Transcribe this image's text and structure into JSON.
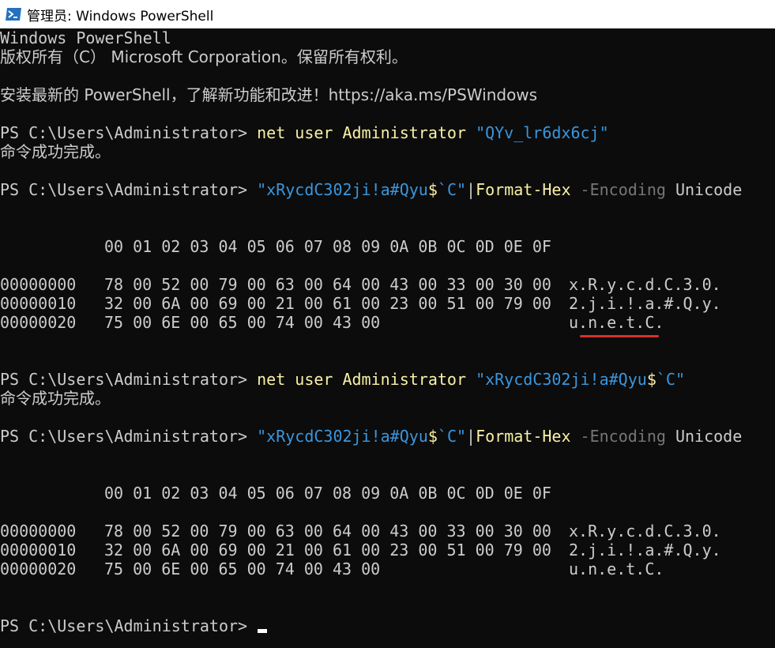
{
  "window": {
    "title": "管理员: Windows PowerShell"
  },
  "banner": {
    "line1": "Windows PowerShell",
    "line2": "版权所有（C） Microsoft Corporation。保留所有权利。",
    "line3": "安装最新的 PowerShell，了解新功能和改进！https://aka.ms/PSWindows"
  },
  "prompt": "PS C:\\Users\\Administrator> ",
  "commands": [
    {
      "cmd": "net user Administrator ",
      "arg": "\"QYv_lr6dx6cj\"",
      "output": "命令成功完成。"
    },
    {
      "str1": "\"xRycdC302ji!a#Qyu",
      "dollar": "$",
      "str2": "`C\"",
      "pipe": "|",
      "cmdlet": "Format-Hex",
      "param": " -Encoding ",
      "value": "Unicode"
    },
    {
      "cmd": "net user Administrator ",
      "arg1": "\"xRycdC302ji!a#Qyu",
      "dollar": "$",
      "arg2": "`C\"",
      "output": "命令成功完成。"
    }
  ],
  "hex": {
    "header": "00 01 02 03 04 05 06 07 08 09 0A 0B 0C 0D 0E 0F",
    "rows": [
      {
        "offset": "00000000",
        "bytes": "78 00 52 00 79 00 63 00 64 00 43 00 33 00 30 00",
        "ascii": "x.R.y.c.d.C.3.0."
      },
      {
        "offset": "00000010",
        "bytes": "32 00 6A 00 69 00 21 00 61 00 23 00 51 00 79 00",
        "ascii": "2.j.i.!.a.#.Q.y."
      },
      {
        "offset": "00000020",
        "bytes": "75 00 6E 00 65 00 74 00 43 00",
        "ascii": "u.n.e.t.C."
      }
    ]
  },
  "colors": {
    "background": "#0c0c0c",
    "foreground": "#cccccc",
    "command": "#f9f1a5",
    "string": "#3a96dd",
    "parameter": "#767676",
    "annotation": "#d8312a"
  }
}
